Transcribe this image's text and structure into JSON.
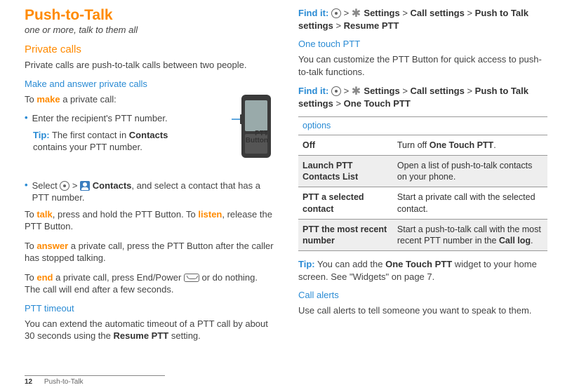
{
  "left": {
    "title": "Push-to-Talk",
    "subtitle": "one or more, talk to them all",
    "h_private": "Private calls",
    "p_private": "Private calls are push-to-talk calls between two people.",
    "h_make": "Make and answer private calls",
    "p_make_pre": "To ",
    "kw_make": "make",
    "p_make_post": " a private call:",
    "bullet1": "Enter the recipient's PTT number.",
    "tip_label": "Tip:",
    "tip_body_a": " The first contact in ",
    "tip_body_b": "Contacts",
    "tip_body_c": " contains your PTT number.",
    "bullet2_a": "Select ",
    "bullet2_b": "Contacts",
    "bullet2_c": ", and select a contact that has a PTT number.",
    "p_talk_a": "To ",
    "kw_talk": "talk",
    "p_talk_b": ", press and hold the PTT Button. To ",
    "kw_listen": "listen",
    "p_talk_c": ", release the PTT Button.",
    "p_ans_a": "To ",
    "kw_answer": "answer",
    "p_ans_b": " a private call, press the PTT Button after the caller has stopped talking.",
    "p_end_a": "To ",
    "kw_end": "end",
    "p_end_b": " a private call, press End/Power ",
    "p_end_c": " or do nothing. The call will end after a few seconds.",
    "h_timeout": "PTT timeout",
    "p_timeout_a": "You can extend the automatic timeout of a PTT call by about 30 seconds using the ",
    "p_timeout_b": "Resume PTT",
    "p_timeout_c": " setting.",
    "ptt_label_a": "PTT",
    "ptt_label_b": "Button"
  },
  "right": {
    "findit": "Find it:",
    "gt": " > ",
    "settings": "Settings",
    "callsettings": "Call settings",
    "pushtotalksettings": "Push to Talk settings",
    "resumeptt": "Resume PTT",
    "h_onetouch": "One touch PTT",
    "p_onetouch": "You can customize the PTT Button for quick access to push-to-talk functions.",
    "onetouchptt": "One Touch PTT",
    "table_caption": "options",
    "row1_l": "Off",
    "row1_r_a": "Turn off ",
    "row1_r_b": "One Touch PTT",
    "row1_r_c": ".",
    "row2_l": "Launch PTT Contacts List",
    "row2_r": "Open a list of push-to-talk contacts on your phone.",
    "row3_l": "PTT a selected contact",
    "row3_r": "Start a private call with the selected contact.",
    "row4_l": "PTT the most recent number",
    "row4_r_a": "Start a push-to-talk call with the most recent PTT number in the ",
    "row4_r_b": "Call log",
    "row4_r_c": ".",
    "tip2_a": "Tip:",
    "tip2_b": " You can add the ",
    "tip2_c": "One Touch PTT",
    "tip2_d": " widget to your home screen. See \"Widgets\" on page 7.",
    "h_callalerts": "Call alerts",
    "p_callalerts": "Use call alerts to tell someone you want to speak to them."
  },
  "footer": {
    "page": "12",
    "section": "Push-to-Talk"
  }
}
